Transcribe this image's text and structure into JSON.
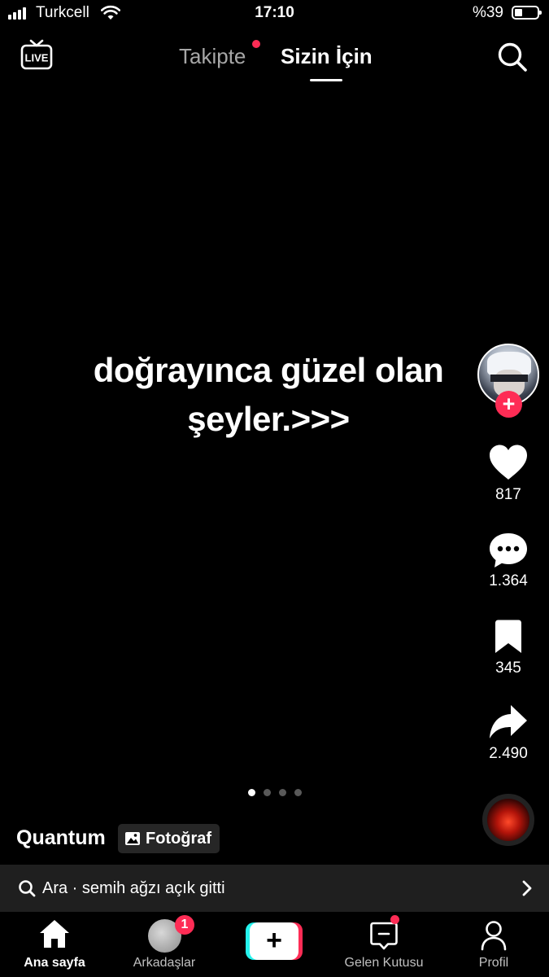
{
  "status_bar": {
    "carrier": "Turkcell",
    "time": "17:10",
    "battery": "%39",
    "battery_fill": 0.39
  },
  "header": {
    "live_label": "LIVE",
    "tabs": [
      {
        "label": "Takipte",
        "active": false,
        "has_dot": true
      },
      {
        "label": "Sizin İçin",
        "active": true
      }
    ]
  },
  "post": {
    "caption_line1": "doğrayınca güzel olan",
    "caption_line2": "şeyler.>>>",
    "author": "Quantum",
    "type_badge": "Fotoğraf",
    "slides_total": 4,
    "slide_active": 1
  },
  "actions": {
    "likes": "817",
    "comments": "1.364",
    "saves": "345",
    "shares": "2.490"
  },
  "suggestion": {
    "text": "Ara · semih ağzı açık gitti"
  },
  "nav": {
    "items": [
      {
        "label": "Ana sayfa",
        "active": true
      },
      {
        "label": "Arkadaşlar",
        "badge": "1"
      },
      {
        "label": ""
      },
      {
        "label": "Gelen Kutusu",
        "has_dot": true
      },
      {
        "label": "Profil"
      }
    ]
  },
  "colors": {
    "accent": "#fe2c55",
    "cyan": "#25f4ee",
    "background": "#000000"
  }
}
